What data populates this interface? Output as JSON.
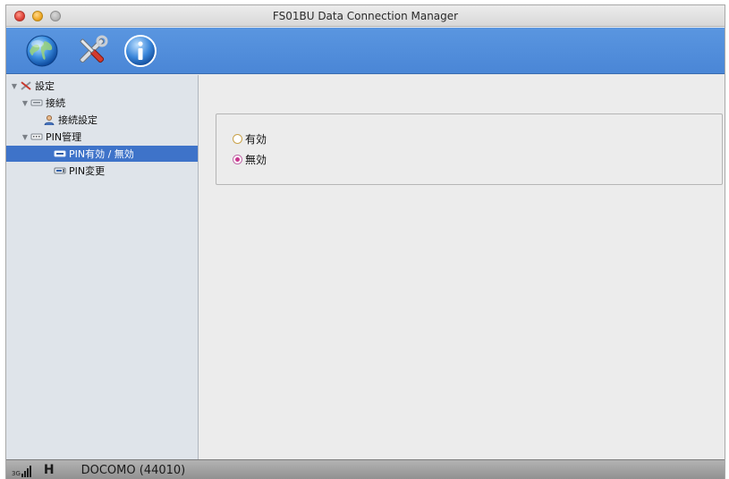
{
  "window": {
    "title": "FS01BU Data Connection Manager"
  },
  "toolbar": {
    "buttons": [
      {
        "icon": "globe-icon"
      },
      {
        "icon": "tools-icon"
      },
      {
        "icon": "info-icon"
      }
    ]
  },
  "sidebar": {
    "items": [
      {
        "label": "設定",
        "icon": "tools-icon",
        "expanded": true
      },
      {
        "label": "接続",
        "icon": "connection-icon",
        "expanded": true
      },
      {
        "label": "接続設定",
        "icon": "user-icon"
      },
      {
        "label": "PIN管理",
        "icon": "pin-card-icon",
        "expanded": true
      },
      {
        "label": "PIN有効 / 無効",
        "icon": "pin-card-icon",
        "selected": true
      },
      {
        "label": "PIN変更",
        "icon": "pin-card-icon"
      }
    ]
  },
  "main": {
    "options": [
      {
        "label": "有効",
        "selected": false
      },
      {
        "label": "無効",
        "selected": true
      }
    ]
  },
  "status": {
    "network_type": "3G",
    "signal_bars": 4,
    "mode": "H",
    "carrier": "DOCOMO (44010)"
  },
  "colors": {
    "toolbar": "#4a86d6",
    "selection": "#3e73c9",
    "sidebar": "#dfe4ea"
  }
}
